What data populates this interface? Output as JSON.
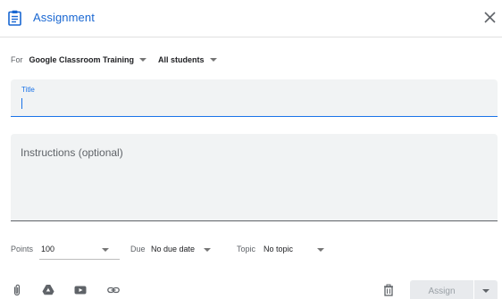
{
  "header": {
    "title": "Assignment",
    "icon": "assignment-icon",
    "close_icon": "close-icon",
    "accent_color": "#1967d2"
  },
  "for_row": {
    "label": "For",
    "class_value": "Google Classroom Training",
    "students_value": "All students"
  },
  "title_field": {
    "label": "Title",
    "value": ""
  },
  "instructions_field": {
    "placeholder": "Instructions (optional)",
    "value": ""
  },
  "meta": {
    "points_label": "Points",
    "points_value": "100",
    "due_label": "Due",
    "due_value": "No due date",
    "topic_label": "Topic",
    "topic_value": "No topic"
  },
  "toolbar": {
    "icons": [
      "attach-icon",
      "google-drive-icon",
      "youtube-icon",
      "link-icon",
      "trash-icon"
    ],
    "assign_label": "Assign"
  }
}
